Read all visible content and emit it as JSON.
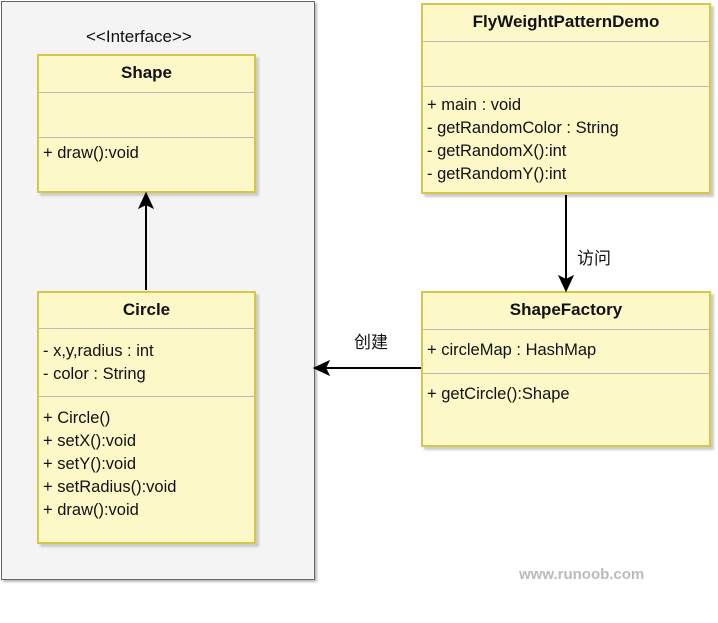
{
  "stereotype": "<<Interface>>",
  "classes": {
    "shape": {
      "name": "Shape",
      "attributes": [],
      "methods": [
        "+ draw():void"
      ]
    },
    "circle": {
      "name": "Circle",
      "attributes": [
        "- x,y,radius : int",
        "- color : String"
      ],
      "methods": [
        "+ Circle()",
        "+ setX():void",
        "+ setY():void",
        "+ setRadius():void",
        "+ draw():void"
      ]
    },
    "demo": {
      "name": "FlyWeightPatternDemo",
      "attributes": [],
      "methods": [
        "+ main : void",
        "- getRandomColor : String",
        "- getRandomX():int",
        "- getRandomY():int"
      ]
    },
    "factory": {
      "name": "ShapeFactory",
      "attributes": [
        "+ circleMap : HashMap"
      ],
      "methods": [
        "+ getCircle():Shape"
      ]
    }
  },
  "edges": {
    "visit": "访问",
    "create": "创建"
  },
  "watermark": "www.runoob.com",
  "colors": {
    "class_fill": "#fcf8c8",
    "class_border": "#d6c847",
    "group_fill": "#f4f4f4"
  }
}
